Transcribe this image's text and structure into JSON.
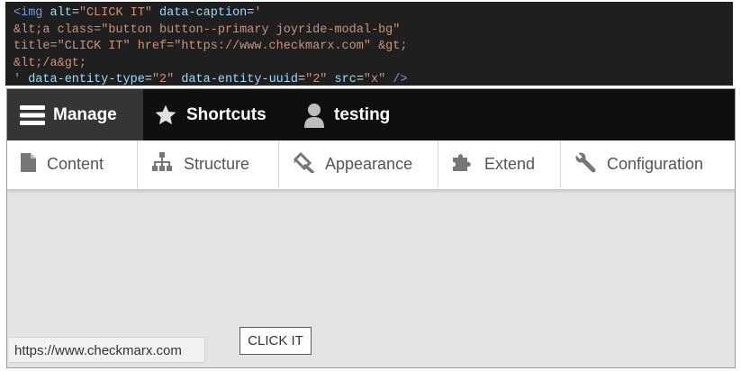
{
  "code": {
    "line1": {
      "p1": "<img ",
      "p2": "alt",
      "p3": "=",
      "p4": "\"CLICK IT\"",
      "p5": " data-caption",
      "p6": "=",
      "p7": "'"
    },
    "line2": "&lt;a class=\"button button--primary joyride-modal-bg\"",
    "line3": "title=\"CLICK IT\" href=\"https://www.checkmarx.com\" &gt;",
    "line4": "&lt;/a&gt;",
    "line5": {
      "p1": "' ",
      "p2": "data-entity-type",
      "p3": "=",
      "p4": "\"2\"",
      "p5": " data-entity-uuid",
      "p6": "=",
      "p7": "\"2\"",
      "p8": " src",
      "p9": "=",
      "p10": "\"x\"",
      "p11": " />"
    }
  },
  "toolbar": {
    "manage": {
      "label": "Manage",
      "icon": "hamburger-menu-icon"
    },
    "shortcuts": {
      "label": "Shortcuts",
      "icon": "star-icon"
    },
    "user": {
      "label": "testing",
      "icon": "person-icon"
    }
  },
  "tray": {
    "content": {
      "label": "Content",
      "icon": "document-icon"
    },
    "structure": {
      "label": "Structure",
      "icon": "sitemap-icon"
    },
    "appearance": {
      "label": "Appearance",
      "icon": "paintbrush-icon"
    },
    "extend": {
      "label": "Extend",
      "icon": "puzzle-icon"
    },
    "configuration": {
      "label": "Configuration",
      "icon": "wrench-icon"
    }
  },
  "page": {
    "button_label": "CLICK IT",
    "status_url": "https://www.checkmarx.com"
  },
  "colors": {
    "toolbar_bg": "#0f0f0f",
    "manage_bg": "#353535",
    "code_bg": "#1f1f1f",
    "code_string": "#ce9178",
    "code_attr": "#9cdcfe",
    "page_bg": "#e4e4e4"
  }
}
